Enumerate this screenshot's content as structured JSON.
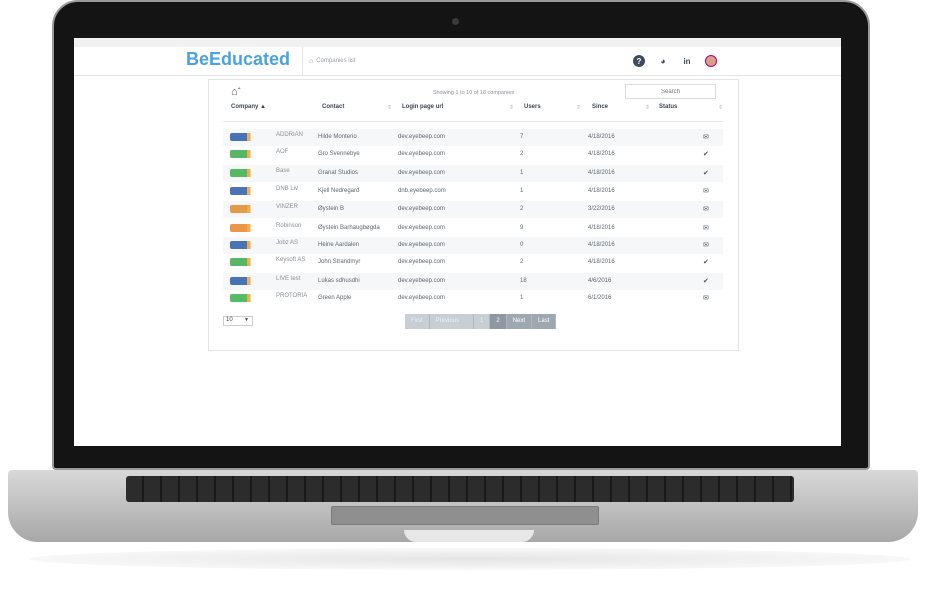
{
  "app": {
    "logo": "BeEducated",
    "breadcrumb": "Companies list"
  },
  "header_icons": [
    "help-icon",
    "pie-chart-icon",
    "linkedin-icon",
    "avatar"
  ],
  "list": {
    "summary": "Showing 1 to 10 of 18 companies",
    "search_placeholder": "Search",
    "columns": [
      "Company",
      "Contact",
      "Login page url",
      "Users",
      "Since",
      "Status"
    ],
    "rows": [
      {
        "company": "ADDRIAN",
        "contact": "Hilde Monterio",
        "url": "dev.eyebeep.com",
        "users": "7",
        "since": "4/18/2016",
        "status": "mail",
        "logo_color": "#2a5caa"
      },
      {
        "company": "AOF",
        "contact": "Gro Svennebye",
        "url": "dev.eyebeep.com",
        "users": "2",
        "since": "4/18/2016",
        "status": "check",
        "logo_color": "#3aa84a"
      },
      {
        "company": "Base",
        "contact": "Granat Studios",
        "url": "dev.eyebeep.com",
        "users": "1",
        "since": "4/18/2016",
        "status": "check",
        "logo_color": "#36b04a"
      },
      {
        "company": "DNB Liv",
        "contact": "Kjell Nedregard",
        "url": "dnb.eyebeep.com",
        "users": "1",
        "since": "4/18/2016",
        "status": "mail",
        "logo_color": "#2a5caa"
      },
      {
        "company": "VINZER",
        "contact": "Øystein B",
        "url": "dev.eyebeep.com",
        "users": "2",
        "since": "3/22/2016",
        "status": "mail",
        "logo_color": "#e08a2a"
      },
      {
        "company": "Robinson",
        "contact": "Øystein Barhaugbøgda",
        "url": "dev.eyebeep.com",
        "users": "9",
        "since": "4/18/2016",
        "status": "mail",
        "logo_color": "#e8842a"
      },
      {
        "company": "Jobz AS",
        "contact": "Heine Aardalen",
        "url": "dev.eyebeep.com",
        "users": "0",
        "since": "4/18/2016",
        "status": "mail",
        "logo_color": "#2a5caa"
      },
      {
        "company": "Keysoft AS",
        "contact": "John Strandmyr",
        "url": "dev.eyebeep.com",
        "users": "2",
        "since": "4/18/2016",
        "status": "check",
        "logo_color": "#3aa84a"
      },
      {
        "company": "LIVE test",
        "contact": "Lukas sdhusdhi",
        "url": "dev.eyebeep.com",
        "users": "18",
        "since": "4/6/2016",
        "status": "check",
        "logo_color": "#2a5caa"
      },
      {
        "company": "PROTORIA",
        "contact": "Green Apple",
        "url": "dev.eyebeep.com",
        "users": "1",
        "since": "6/1/2016",
        "status": "mail",
        "logo_color": "#36b04a"
      }
    ],
    "page_size": "10",
    "pager": {
      "first": "First",
      "previous": "Previous",
      "page1": "1",
      "page2": "2",
      "next": "Next",
      "last": "Last"
    }
  }
}
